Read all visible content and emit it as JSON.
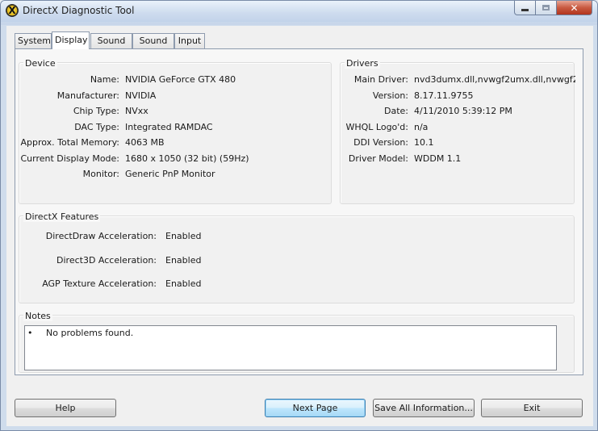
{
  "window": {
    "title": "DirectX Diagnostic Tool",
    "app_icon_letter": "X"
  },
  "window_controls": {
    "minimize": "minimize",
    "maximize": "maximize",
    "close": "✕"
  },
  "tabs": [
    {
      "label": "System"
    },
    {
      "label": "Display",
      "active": true
    },
    {
      "label": "Sound 1"
    },
    {
      "label": "Sound 2"
    },
    {
      "label": "Input"
    }
  ],
  "device": {
    "title": "Device",
    "rows": [
      {
        "label": "Name:",
        "value": "NVIDIA GeForce GTX 480"
      },
      {
        "label": "Manufacturer:",
        "value": "NVIDIA"
      },
      {
        "label": "Chip Type:",
        "value": "NVxx"
      },
      {
        "label": "DAC Type:",
        "value": "Integrated RAMDAC"
      },
      {
        "label": "Approx. Total Memory:",
        "value": "4063 MB"
      },
      {
        "label": "Current Display Mode:",
        "value": "1680 x 1050 (32 bit) (59Hz)"
      },
      {
        "label": "Monitor:",
        "value": "Generic PnP Monitor"
      }
    ]
  },
  "drivers": {
    "title": "Drivers",
    "rows": [
      {
        "label": "Main Driver:",
        "value": "nvd3dumx.dll,nvwgf2umx.dll,nvwgf2"
      },
      {
        "label": "Version:",
        "value": "8.17.11.9755"
      },
      {
        "label": "Date:",
        "value": "4/11/2010 5:39:12 PM"
      },
      {
        "label": "WHQL Logo'd:",
        "value": "n/a"
      },
      {
        "label": "DDI Version:",
        "value": "10.1"
      },
      {
        "label": "Driver Model:",
        "value": "WDDM 1.1"
      }
    ]
  },
  "features": {
    "title": "DirectX Features",
    "rows": [
      {
        "label": "DirectDraw Acceleration:",
        "value": "Enabled"
      },
      {
        "label": "Direct3D Acceleration:",
        "value": "Enabled"
      },
      {
        "label": "AGP Texture Acceleration:",
        "value": "Enabled"
      }
    ]
  },
  "notes": {
    "title": "Notes",
    "bullet": "•",
    "lines": [
      "No problems found."
    ]
  },
  "buttons": {
    "help": "Help",
    "next_page": "Next Page",
    "save_all": "Save All Information...",
    "exit": "Exit"
  }
}
